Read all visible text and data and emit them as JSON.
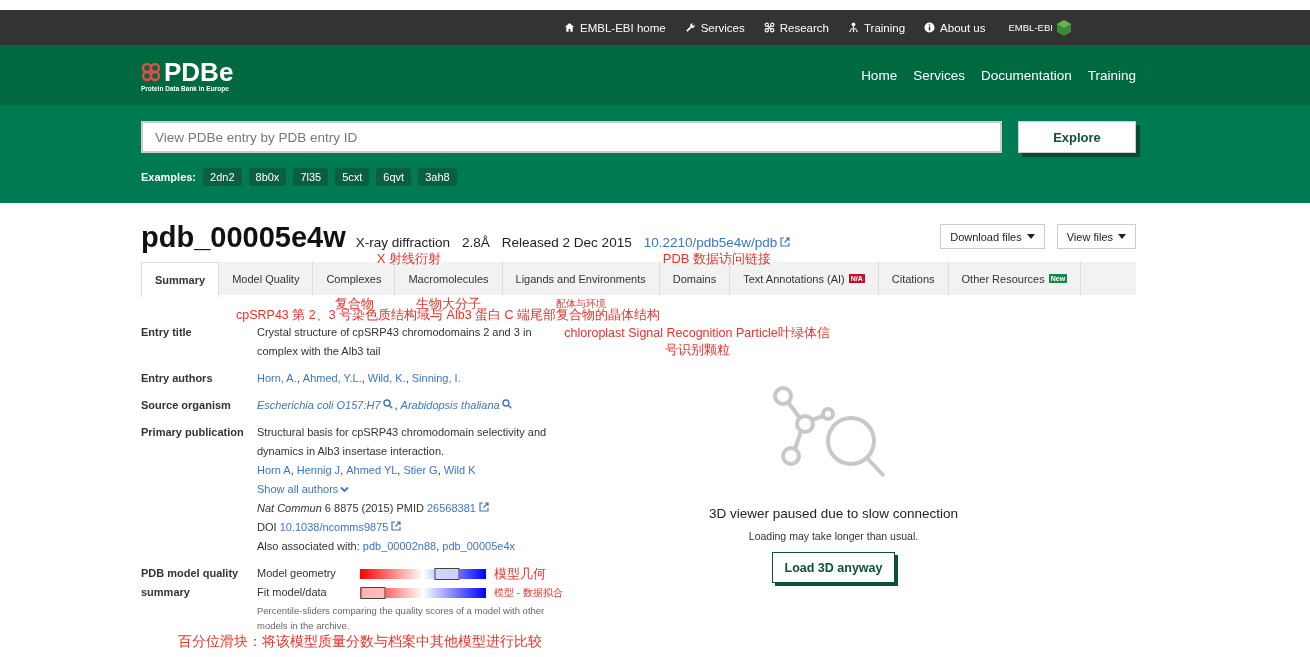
{
  "top_bar": {
    "links": [
      {
        "label": "EMBL-EBI home",
        "kind": "home"
      },
      {
        "label": "Services",
        "kind": "wrench"
      },
      {
        "label": "Research",
        "kind": "network"
      },
      {
        "label": "Training",
        "kind": "people"
      },
      {
        "label": "About us",
        "kind": "info"
      }
    ],
    "brand": "EMBL-EBI"
  },
  "header": {
    "logo": "PDBe",
    "logo_subtitle": "Protein Data Bank in Europe",
    "nav": [
      "Home",
      "Services",
      "Documentation",
      "Training"
    ]
  },
  "search": {
    "placeholder": "View PDBe entry by PDB entry ID",
    "button": "Explore",
    "examples_label": "Examples:",
    "examples": [
      "2dn2",
      "8b0x",
      "7l35",
      "5cxt",
      "6qvt",
      "3ah8"
    ]
  },
  "entry": {
    "id": "pdb_00005e4w",
    "method": "X-ray diffraction",
    "method_note": "X 射线衍射",
    "resolution": "2.8Å",
    "released": "Released 2 Dec 2015",
    "doi": "10.2210/pdb5e4w/pdb",
    "doi_note": "PDB 数据访问链接",
    "buttons": [
      "Download files",
      "View files"
    ]
  },
  "tabs": [
    {
      "label": "Summary",
      "selected": true
    },
    {
      "label": "Model Quality",
      "selected": false
    },
    {
      "label": "Complexes",
      "selected": false,
      "note": "复合物"
    },
    {
      "label": "Macromolecules",
      "selected": false,
      "note": "生物大分子"
    },
    {
      "label": "Ligands and Environments",
      "selected": false,
      "note": "配体与环境"
    },
    {
      "label": "Domains",
      "selected": false
    },
    {
      "label": "Text Annotations (AI)",
      "selected": false,
      "badge": {
        "text": "N/A",
        "kind": "alert"
      }
    },
    {
      "label": "Citations",
      "selected": false
    },
    {
      "label": "Other Resources",
      "selected": false,
      "badge": {
        "text": "New",
        "kind": "new"
      }
    }
  ],
  "entry_title": {
    "label": "Entry title",
    "value": "Crystal structure of cpSRP43 chromodomains 2 and 3 in complex with the Alb3 tail",
    "notes": [
      "cpSRP43 第 2、3 号染色质结构域与 Alb3 蛋白 C 端尾部复合物的晶体结构",
      "chloroplast Signal Recognition Particle叶绿体信号识别颗粒"
    ]
  },
  "entry_authors": {
    "label": "Entry authors",
    "authors": [
      "Horn, A.",
      "Ahmed, Y.L.",
      "Wild, K.",
      "Sinning, I."
    ],
    "separator": ","
  },
  "source_organism": {
    "label": "Source organism",
    "organisms": [
      "Escherichia coli O157:H7",
      "Arabidopsis thaliana"
    ],
    "separator": ","
  },
  "primary_publication": {
    "label": "Primary publication",
    "title": "Structural basis for cpSRP43 chromodomain selectivity and dynamics in Alb3 insertase interaction.",
    "authors": [
      "Horn A",
      "Hennig J",
      "Ahmed YL",
      "Stier G",
      "Wild K"
    ],
    "separator": ",",
    "show_all": "Show all authors",
    "journal": "Nat Commun",
    "citation": "6 8875 (2015) PMID",
    "pmid": "26568381",
    "doi_label": "DOI",
    "doi": "10.1038/ncomms9875",
    "also_label": "Also associated with:",
    "also": [
      "pdb_00002n88",
      "pdb_00005e4x"
    ]
  },
  "model_quality": {
    "label": "PDB model quality summary",
    "sliders": [
      {
        "name": "Model geometry",
        "level": 0.69,
        "note": "模型几何"
      },
      {
        "name": "Fit model/data",
        "level": 0.1,
        "note": "模型 - 数据拟合"
      }
    ],
    "caption": "Percentile-sliders comparing the quality scores of a model with other models in the archive.",
    "caption_note": "百分位滑块：将该模型质量分数与档案中其他模型进行比较"
  },
  "viewer": {
    "heading": "3D viewer paused due to slow connection",
    "message": "Loading may take longer than usual.",
    "button": "Load 3D anyway"
  }
}
